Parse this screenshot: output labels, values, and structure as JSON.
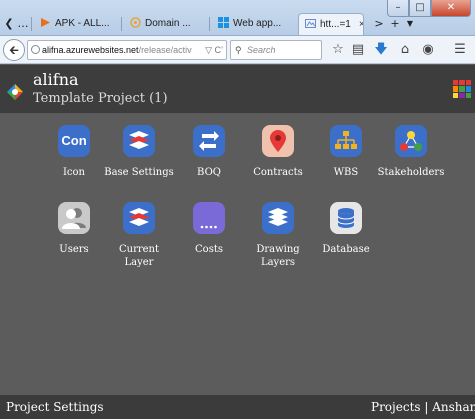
{
  "browser": {
    "tabs": [
      {
        "label": "APK - ALL..."
      },
      {
        "label": "Domain ..."
      },
      {
        "label": "Web app..."
      },
      {
        "label": "htt...=1",
        "active": true
      }
    ],
    "url_host": "alifna.azurewebsites.net",
    "url_path": "/release/activ",
    "search_placeholder": "Search",
    "close_glyph": "×",
    "new_tab_glyph": "+"
  },
  "app": {
    "title": "alifna",
    "subtitle": "Template Project (1)",
    "icon_text": "Con",
    "tiles": [
      {
        "label": "Icon",
        "icon": "con-icon"
      },
      {
        "label": "Base Settings",
        "icon": "layers-icon"
      },
      {
        "label": "BOQ",
        "icon": "exchange-icon"
      },
      {
        "label": "Contracts",
        "icon": "map-pin-icon"
      },
      {
        "label": "WBS",
        "icon": "hierarchy-icon"
      },
      {
        "label": "Stakeholders",
        "icon": "network-icon"
      },
      {
        "label": "Users",
        "icon": "users-icon"
      },
      {
        "label": "Current Layer",
        "icon": "layers-icon"
      },
      {
        "label": "Costs",
        "icon": "costs-icon"
      },
      {
        "label": "Drawing Layers",
        "icon": "stack-icon"
      },
      {
        "label": "Database",
        "icon": "database-icon"
      }
    ],
    "footer_left": "Project Settings",
    "footer_right": "Projects |  Anshan"
  },
  "colors": {
    "workspace": "#5c5c5c",
    "header": "#3d3d3d",
    "icon_blue": "#3b6fc9",
    "icon_purple": "#7a6ad8",
    "icon_peach": "#f0c2ad",
    "icon_gray": "#c9c9c9"
  }
}
